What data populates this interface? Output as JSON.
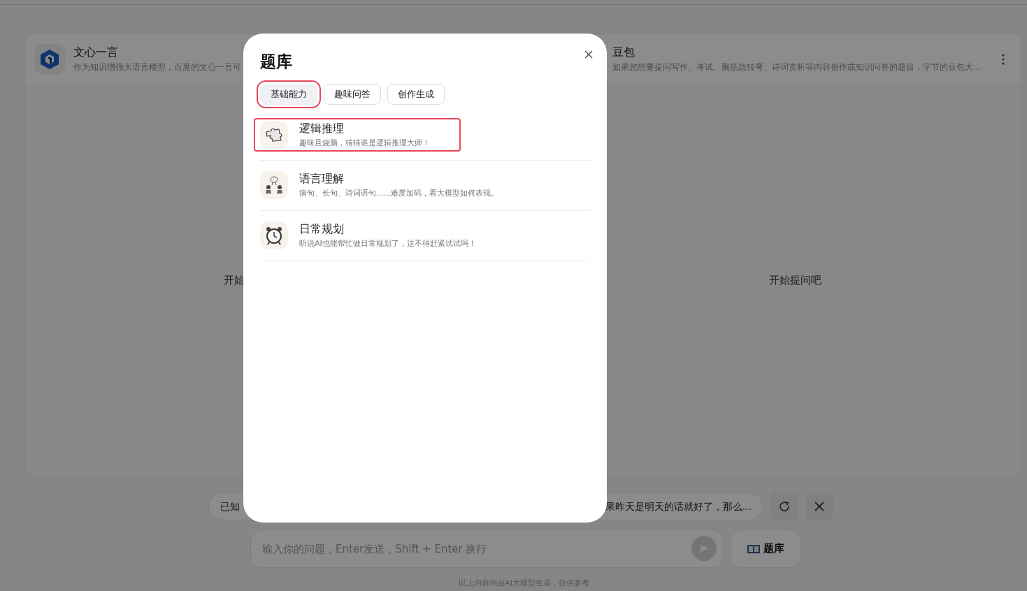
{
  "background": {
    "models": [
      {
        "name": "文心一言",
        "description": "作为知识增强大语言模型，百度的文心一言可",
        "placeholder_text": "开始",
        "logo": true
      },
      {
        "name": "豆包",
        "description": "如果您想要提问写作、考试、脑筋急转弯、诗词赏析等内容创作或知识问答的题目，字节的豆包大...",
        "placeholder_text": "开始提问吧",
        "logo": false
      }
    ],
    "suggestions": [
      "已知",
      "果昨天是明天的话就好了，那么..."
    ],
    "input": {
      "placeholder": "输入你的问题，Enter发送，Shift + Enter 换行"
    },
    "question_bank_button": "题库",
    "footer": "以上内容均由AI大模型生成，仅供参考"
  },
  "dialog": {
    "title": "题库",
    "tabs": [
      {
        "label": "基础能力",
        "selected": true,
        "highlighted": true
      },
      {
        "label": "趣味问答",
        "selected": false,
        "highlighted": false
      },
      {
        "label": "创作生成",
        "selected": false,
        "highlighted": false
      }
    ],
    "items": [
      {
        "kind": "puzzle",
        "title": "逻辑推理",
        "description": "趣味且烧脑，猜猜谁是逻辑推理大师！",
        "highlighted": true
      },
      {
        "kind": "conversation",
        "title": "语言理解",
        "description": "病句、长句、诗词语句......难度加码，看大模型如何表现。",
        "highlighted": false
      },
      {
        "kind": "clock",
        "title": "日常规划",
        "description": "听说AI也能帮忙做日常规划了，这不得赶紧试试吗！",
        "highlighted": false
      }
    ]
  }
}
